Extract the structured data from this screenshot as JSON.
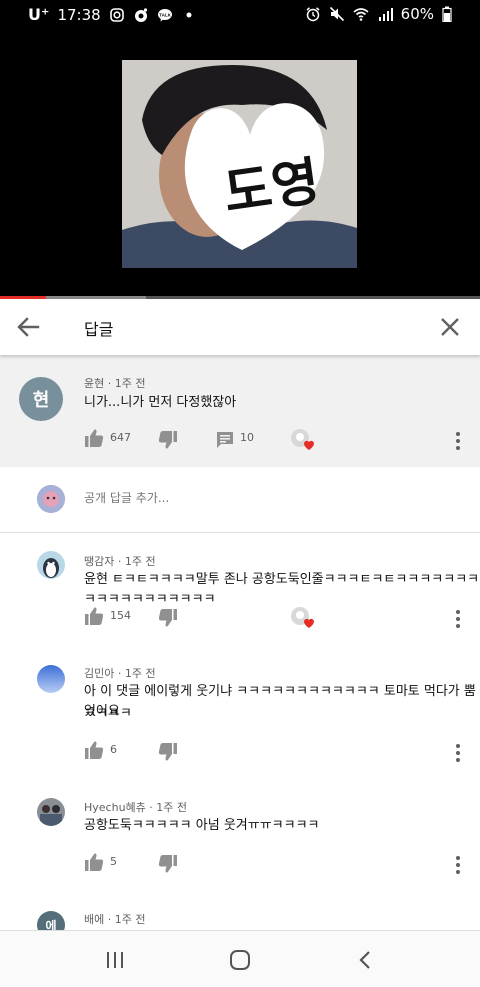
{
  "status_bar": {
    "carrier": "U⁺",
    "time": "17:38",
    "battery": "60%"
  },
  "video": {
    "overlay_text": "도영",
    "progress_fraction": 0.096
  },
  "header": {
    "title": "답글"
  },
  "parent_comment": {
    "avatar_letter": "현",
    "author": "윤현",
    "time": "1주 전",
    "text": "니가...니가 먼저 다정했잖아",
    "likes": "647",
    "replies": "10"
  },
  "add_reply": {
    "placeholder": "공개 답글 추가..."
  },
  "replies": [
    {
      "author": "땡감자",
      "time": "1주 전",
      "text": "윤현 ㅌㅋㅌㅋㅋㅋㅋ말투 존나 공항도둑인줄ㅋㅋㅋㅌㅋㅌㅋㅋㅋㅋㅋㅋㅋㅋㅋㅋㅋㅋㅋㅋㅋㅋㅋㅋ",
      "likes": "154",
      "creator_hearted": true
    },
    {
      "author": "김민아",
      "time": "1주 전",
      "text_line1": "아 이 댓글 에이렇게 웃기냐 ㅋㅋㅋㅋㅋㅋㅋㅋㅋㅋㅋㅋ 토마토 먹다가 뿜었어요",
      "text_line2": "ㅋㅋㅋㅋ",
      "likes": "6",
      "creator_hearted": false
    },
    {
      "author": "Hyechu혜츄",
      "time": "1주 전",
      "text": "공항도둑ㅋㅋㅋㅋㅋ 아넘 웃겨ㅠㅠㅋㅋㅋㅋ",
      "likes": "5",
      "creator_hearted": false
    },
    {
      "avatar_letter": "에",
      "author": "배에",
      "time": "1주 전"
    }
  ],
  "colors": {
    "progress_played": "#e52d27",
    "heart": "#e52d27",
    "parent_bg": "#f1f1f1",
    "parent_avatar": "#78909c"
  }
}
